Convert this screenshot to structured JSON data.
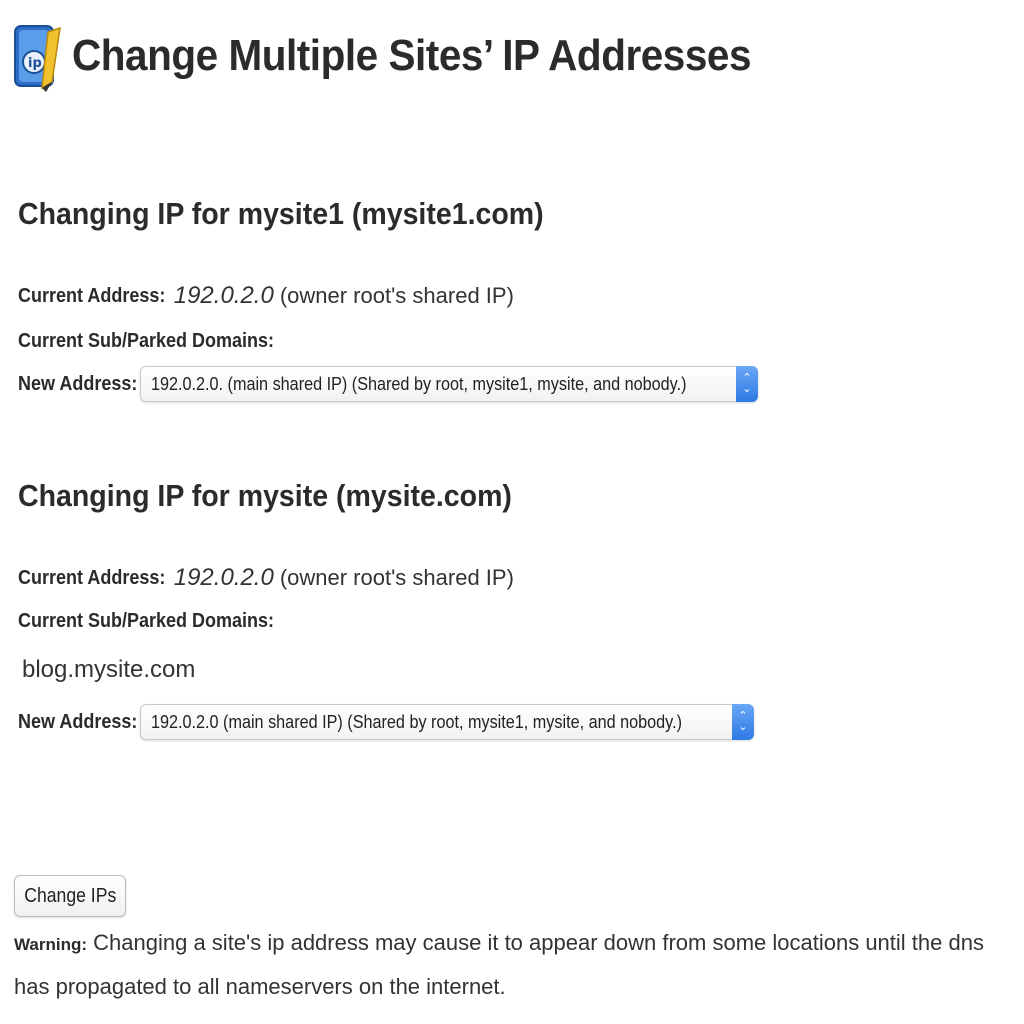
{
  "page": {
    "title": "Change Multiple Sites’ IP Addresses",
    "icon": "ip-address-app-icon"
  },
  "sites": [
    {
      "heading": "Changing IP for mysite1 (mysite1.com)",
      "current_address_label": "Current Address:",
      "current_address_value": "192.0.2.0",
      "current_address_note": "(owner root's shared IP)",
      "domains_label": "Current Sub/Parked Domains:",
      "domains": [],
      "new_address_label": "New Address:",
      "new_address_selected": "192.0.2.0. (main shared IP) (Shared by root, mysite1, mysite, and nobody.)"
    },
    {
      "heading": "Changing IP for mysite (mysite.com)",
      "current_address_label": "Current Address:",
      "current_address_value": "192.0.2.0",
      "current_address_note": "(owner root's shared IP)",
      "domains_label": "Current Sub/Parked Domains:",
      "domains": [
        "blog.mysite.com"
      ],
      "new_address_label": "New Address:",
      "new_address_selected": "192.0.2.0 (main shared IP) (Shared by root, mysite1, mysite, and nobody.)"
    }
  ],
  "actions": {
    "change_ips_label": "Change IPs"
  },
  "warning": {
    "label": "Warning:",
    "text": "Changing a site's ip address may cause it to appear down from some locations until the dns has propagated to all nameservers on the internet."
  },
  "colors": {
    "stepper_accent": "#2f7ae5"
  }
}
